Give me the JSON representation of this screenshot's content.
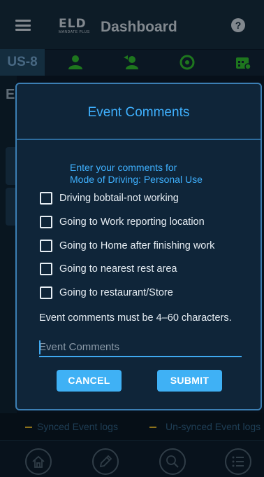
{
  "header": {
    "logo_text": "ELD",
    "logo_subtext": "MANDATE PLUS",
    "title": "Dashboard",
    "help_glyph": "?"
  },
  "toolbar": {
    "vehicle_id": "US-8",
    "icons": [
      "driver-icon",
      "codriver-icon",
      "sync-icon",
      "calendar-icon"
    ],
    "icon_color": "#2fb62f"
  },
  "background": {
    "partial_letter": "E"
  },
  "legend": {
    "synced_label": "Synced Event logs",
    "unsynced_label": "Un-synced Event logs",
    "marker_color": "#d9b02a"
  },
  "bottom_nav": [
    "home-icon",
    "edit-icon",
    "search-icon",
    "list-icon"
  ],
  "dialog": {
    "title": "Event Comments",
    "prompt_line1": "Enter your comments for",
    "prompt_line2": "Mode of Driving: Personal Use",
    "options": [
      {
        "label": "Driving bobtail-not working",
        "checked": false
      },
      {
        "label": "Going to Work reporting location",
        "checked": false
      },
      {
        "label": "Going to Home after finishing work",
        "checked": false
      },
      {
        "label": "Going to nearest rest area",
        "checked": false
      },
      {
        "label": "Going to restaurant/Store",
        "checked": false
      }
    ],
    "hint": "Event comments must be 4–60 characters.",
    "input_value": "",
    "input_placeholder": "Event Comments",
    "cancel_label": "CANCEL",
    "submit_label": "SUBMIT",
    "accent_color": "#3fb1ff"
  }
}
